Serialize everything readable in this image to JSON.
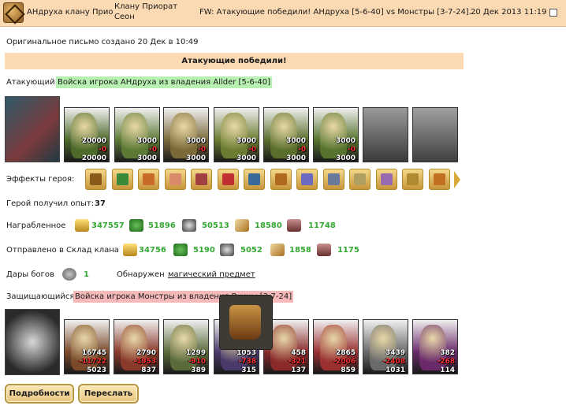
{
  "header": {
    "from": "АНдруха клану Прио",
    "to": "Клану Приорат Сеон",
    "subject": "FW: Атакующие победили! АНдруха [5-6-40] vs Монстры [3-7-24]...",
    "date": "20 Дек 2013 11:19"
  },
  "created_line": "Оригинальное письмо создано 20 Дек в 10:49",
  "banner": "Атакующие победили!",
  "attacker": {
    "label": "Атакующий",
    "name": "Войска игрока АНдруха из владения Allder [5-6-40]",
    "units": [
      {
        "a": "20000",
        "b": "-0",
        "c": "20000",
        "color": "#4d6a2a"
      },
      {
        "a": "3000",
        "b": "-0",
        "c": "3000",
        "color": "#5c7a36"
      },
      {
        "a": "3000",
        "b": "-0",
        "c": "3000",
        "color": "#7a6a3a"
      },
      {
        "a": "3000",
        "b": "-0",
        "c": "3000",
        "color": "#6b7c30"
      },
      {
        "a": "3000",
        "b": "-0",
        "c": "3000",
        "color": "#5a6e2c"
      },
      {
        "a": "3000",
        "b": "-0",
        "c": "3000",
        "color": "#56732e"
      }
    ]
  },
  "effects_label": "Эффекты героя:",
  "effect_icons": [
    "helmet-icon",
    "sword-icon",
    "handshake-icon",
    "hand-icon",
    "chest-icon",
    "dice-icon",
    "shield-icon",
    "scroll-icon",
    "sun-icon",
    "amulet-icon",
    "gift-icon",
    "ring-icon",
    "dagger-icon",
    "crest-icon"
  ],
  "experience": {
    "label": "Герой получил опыт:",
    "value": "37"
  },
  "loot": {
    "label": "Награбленное",
    "values": [
      "347557",
      "51896",
      "50513",
      "18580",
      "11748"
    ]
  },
  "clan": {
    "label": "Отправлено в Склад клана",
    "values": [
      "34756",
      "5190",
      "5052",
      "1858",
      "1175"
    ]
  },
  "gifts": {
    "label": "Дары богов",
    "value": "1",
    "found_label": "Обнаружен",
    "found_link": "магический предмет"
  },
  "defender": {
    "label": "Защищающийся",
    "name": "Войска игрока Монстры из владения Руины [3-7-24]",
    "units": [
      {
        "a": "16745",
        "b": "-11722",
        "c": "5023",
        "color": "#7a4a2a"
      },
      {
        "a": "2790",
        "b": "-1953",
        "c": "837",
        "color": "#8a3a2a"
      },
      {
        "a": "1299",
        "b": "-910",
        "c": "389",
        "color": "#5a6a3a"
      },
      {
        "a": "1053",
        "b": "-738",
        "c": "315",
        "color": "#4a3a6a"
      },
      {
        "a": "458",
        "b": "-321",
        "c": "137",
        "color": "#8a2a2a"
      },
      {
        "a": "2865",
        "b": "-2006",
        "c": "859",
        "color": "#9a3030"
      },
      {
        "a": "3439",
        "b": "-2408",
        "c": "1031",
        "color": "#6a6a6a"
      },
      {
        "a": "382",
        "b": "-268",
        "c": "114",
        "color": "#6a2a6a"
      }
    ]
  },
  "buttons": {
    "details": "Подробности",
    "forward": "Переслать"
  }
}
